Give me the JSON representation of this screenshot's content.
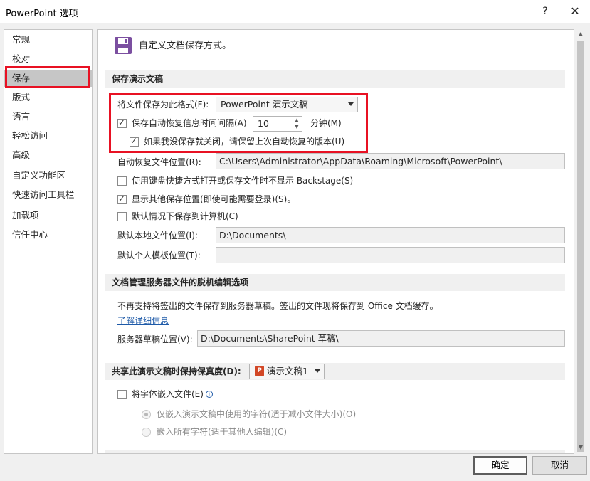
{
  "window": {
    "title": "PowerPoint 选项",
    "help": "?",
    "close": "✕"
  },
  "nav": {
    "items": [
      "常规",
      "校对",
      "保存",
      "版式",
      "语言",
      "轻松访问",
      "高级",
      "自定义功能区",
      "快速访问工具栏",
      "加载项",
      "信任中心"
    ],
    "selected": "保存"
  },
  "header": {
    "icon": "save-icon",
    "text": "自定义文档保存方式。"
  },
  "save_presentations": {
    "title": "保存演示文稿",
    "format_label": "将文件保存为此格式(F):",
    "format_value": "PowerPoint 演示文稿",
    "autorecover_label": "保存自动恢复信息时间间隔(A)",
    "autorecover_checked": true,
    "interval_value": "10",
    "interval_unit": "分钟(M)",
    "keep_last_label": "如果我没保存就关闭，请保留上次自动恢复的版本(U)",
    "keep_last_checked": true,
    "autorecover_location_label": "自动恢复文件位置(R):",
    "autorecover_location_value": "C:\\Users\\Administrator\\AppData\\Roaming\\Microsoft\\PowerPoint\\",
    "no_backstage_label": "使用键盘快捷方式打开或保存文件时不显示 Backstage(S)",
    "no_backstage_checked": false,
    "show_other_label": "显示其他保存位置(即使可能需要登录)(S)。",
    "show_other_checked": true,
    "save_to_computer_label": "默认情况下保存到计算机(C)",
    "save_to_computer_checked": false,
    "default_local_label": "默认本地文件位置(I):",
    "default_local_value": "D:\\Documents\\",
    "default_template_label": "默认个人模板位置(T):",
    "default_template_value": ""
  },
  "offline_editing": {
    "title": "文档管理服务器文件的脱机编辑选项",
    "description": "不再支持将签出的文件保存到服务器草稿。签出的文件现将保存到 Office 文档缓存。",
    "learn_more": "了解详细信息",
    "drafts_label": "服务器草稿位置(V):",
    "drafts_value": "D:\\Documents\\SharePoint 草稿\\"
  },
  "fidelity": {
    "title": "共享此演示文稿时保持保真度(D):",
    "presentation_value": "演示文稿1",
    "embed_fonts_label": "将字体嵌入文件(E)",
    "embed_fonts_checked": false,
    "info_icon": "i",
    "embed_used_label": "仅嵌入演示文稿中使用的字符(适于减小文件大小)(O)",
    "embed_used_selected": true,
    "embed_all_label": "嵌入所有字符(适于其他人编辑)(C)",
    "embed_all_selected": false
  },
  "buttons": {
    "ok": "确定",
    "cancel": "取消"
  },
  "scrollbar": {
    "up": "▲",
    "down": "▼"
  }
}
